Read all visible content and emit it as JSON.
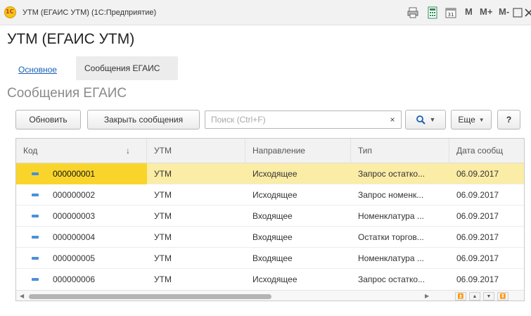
{
  "window": {
    "logo_text": "1С",
    "title": "УТМ (ЕГАИС УТМ)  (1С:Предприятие)",
    "memory_buttons": [
      "M",
      "M+",
      "M-"
    ]
  },
  "form": {
    "title": "УТМ (ЕГАИС УТМ)",
    "nav": {
      "link_main": "Основное",
      "tab_messages": "Сообщения ЕГАИС"
    },
    "section_title": "Сообщения ЕГАИС"
  },
  "toolbar": {
    "refresh_label": "Обновить",
    "close_messages_label": "Закрыть сообщения",
    "search_placeholder": "Поиск (Ctrl+F)",
    "search_clear": "×",
    "more_label": "Еще",
    "help_label": "?"
  },
  "table": {
    "columns": [
      "Код",
      "УТМ",
      "Направление",
      "Тип",
      "Дата сообщ"
    ],
    "sort_indicator": "↓",
    "rows": [
      {
        "code": "000000001",
        "utm": "УТМ",
        "direction": "Исходящее",
        "type": "Запрос остатко...",
        "date": "06.09.2017",
        "selected": true
      },
      {
        "code": "000000002",
        "utm": "УТМ",
        "direction": "Исходящее",
        "type": "Запрос номенк...",
        "date": "06.09.2017",
        "selected": false
      },
      {
        "code": "000000003",
        "utm": "УТМ",
        "direction": "Входящее",
        "type": "Номенклатура ...",
        "date": "06.09.2017",
        "selected": false
      },
      {
        "code": "000000004",
        "utm": "УТМ",
        "direction": "Входящее",
        "type": "Остатки торгов...",
        "date": "06.09.2017",
        "selected": false
      },
      {
        "code": "000000005",
        "utm": "УТМ",
        "direction": "Входящее",
        "type": "Номенклатура ...",
        "date": "06.09.2017",
        "selected": false
      },
      {
        "code": "000000006",
        "utm": "УТМ",
        "direction": "Исходящее",
        "type": "Запрос остатко...",
        "date": "06.09.2017",
        "selected": false
      }
    ]
  },
  "colors": {
    "selected_row": "#fbeca6",
    "selected_cell": "#f9d52c",
    "link": "#1a5fb4",
    "row_icon": "#4a90d9"
  },
  "icons": {
    "print": "printer-icon",
    "calculator": "calculator-icon",
    "calendar": "calendar-icon",
    "maximize": "maximize-icon",
    "close": "close-icon",
    "search": "search-icon",
    "row": "message-row-icon",
    "scroll_left": "scroll-left-icon",
    "scroll_right": "scroll-right-icon",
    "first": "go-first-icon",
    "up": "go-up-icon",
    "down": "go-down-icon",
    "last": "go-last-icon"
  },
  "calendar_day": "31"
}
